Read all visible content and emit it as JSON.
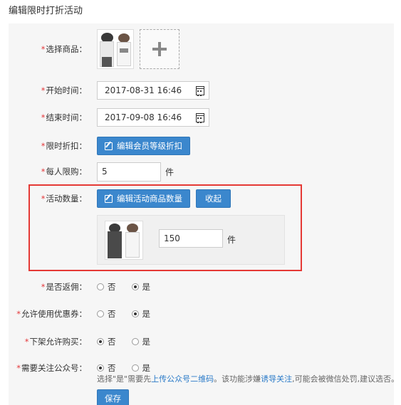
{
  "page": {
    "title": "编辑限时打折活动"
  },
  "form": {
    "product": {
      "label": "选择商品："
    },
    "start_time": {
      "label": "开始时间：",
      "value": "2017-08-31 16:46"
    },
    "end_time": {
      "label": "结束时间：",
      "value": "2017-09-08 16:46"
    },
    "discount": {
      "label": "限时折扣：",
      "button": "编辑会员等级折扣"
    },
    "limit_per_person": {
      "label": "每人限购：",
      "value": "5",
      "unit": "件"
    },
    "activity_qty": {
      "label": "活动数量：",
      "edit_button": "编辑活动商品数量",
      "collapse_button": "收起",
      "item_qty": "150",
      "unit": "件"
    },
    "rebate": {
      "label": "是否返佣：",
      "options": [
        "否",
        "是"
      ],
      "selected": "是"
    },
    "coupon": {
      "label": "允许使用优惠券：",
      "options": [
        "否",
        "是"
      ],
      "selected": "是"
    },
    "offshelf_buy": {
      "label": "下架允许购买：",
      "options": [
        "否",
        "是"
      ],
      "selected": "否"
    },
    "follow_official": {
      "label": "需要关注公众号：",
      "options": [
        "否",
        "是"
      ],
      "selected": "否",
      "hint_prefix": "选择\"是\"需要先",
      "hint_link1": "上传公众号二维码",
      "hint_mid": "。该功能涉嫌",
      "hint_link2": "诱导关注",
      "hint_suffix": ",可能会被微信处罚,建议选否。"
    },
    "save_button": "保存"
  },
  "colors": {
    "primary": "#3b87cd",
    "required": "#e4393c",
    "highlight_border": "#e53935",
    "link": "#2a7ac8"
  },
  "icons": {
    "date": "calendar-icon",
    "edit": "edit-icon",
    "add": "plus-icon"
  }
}
